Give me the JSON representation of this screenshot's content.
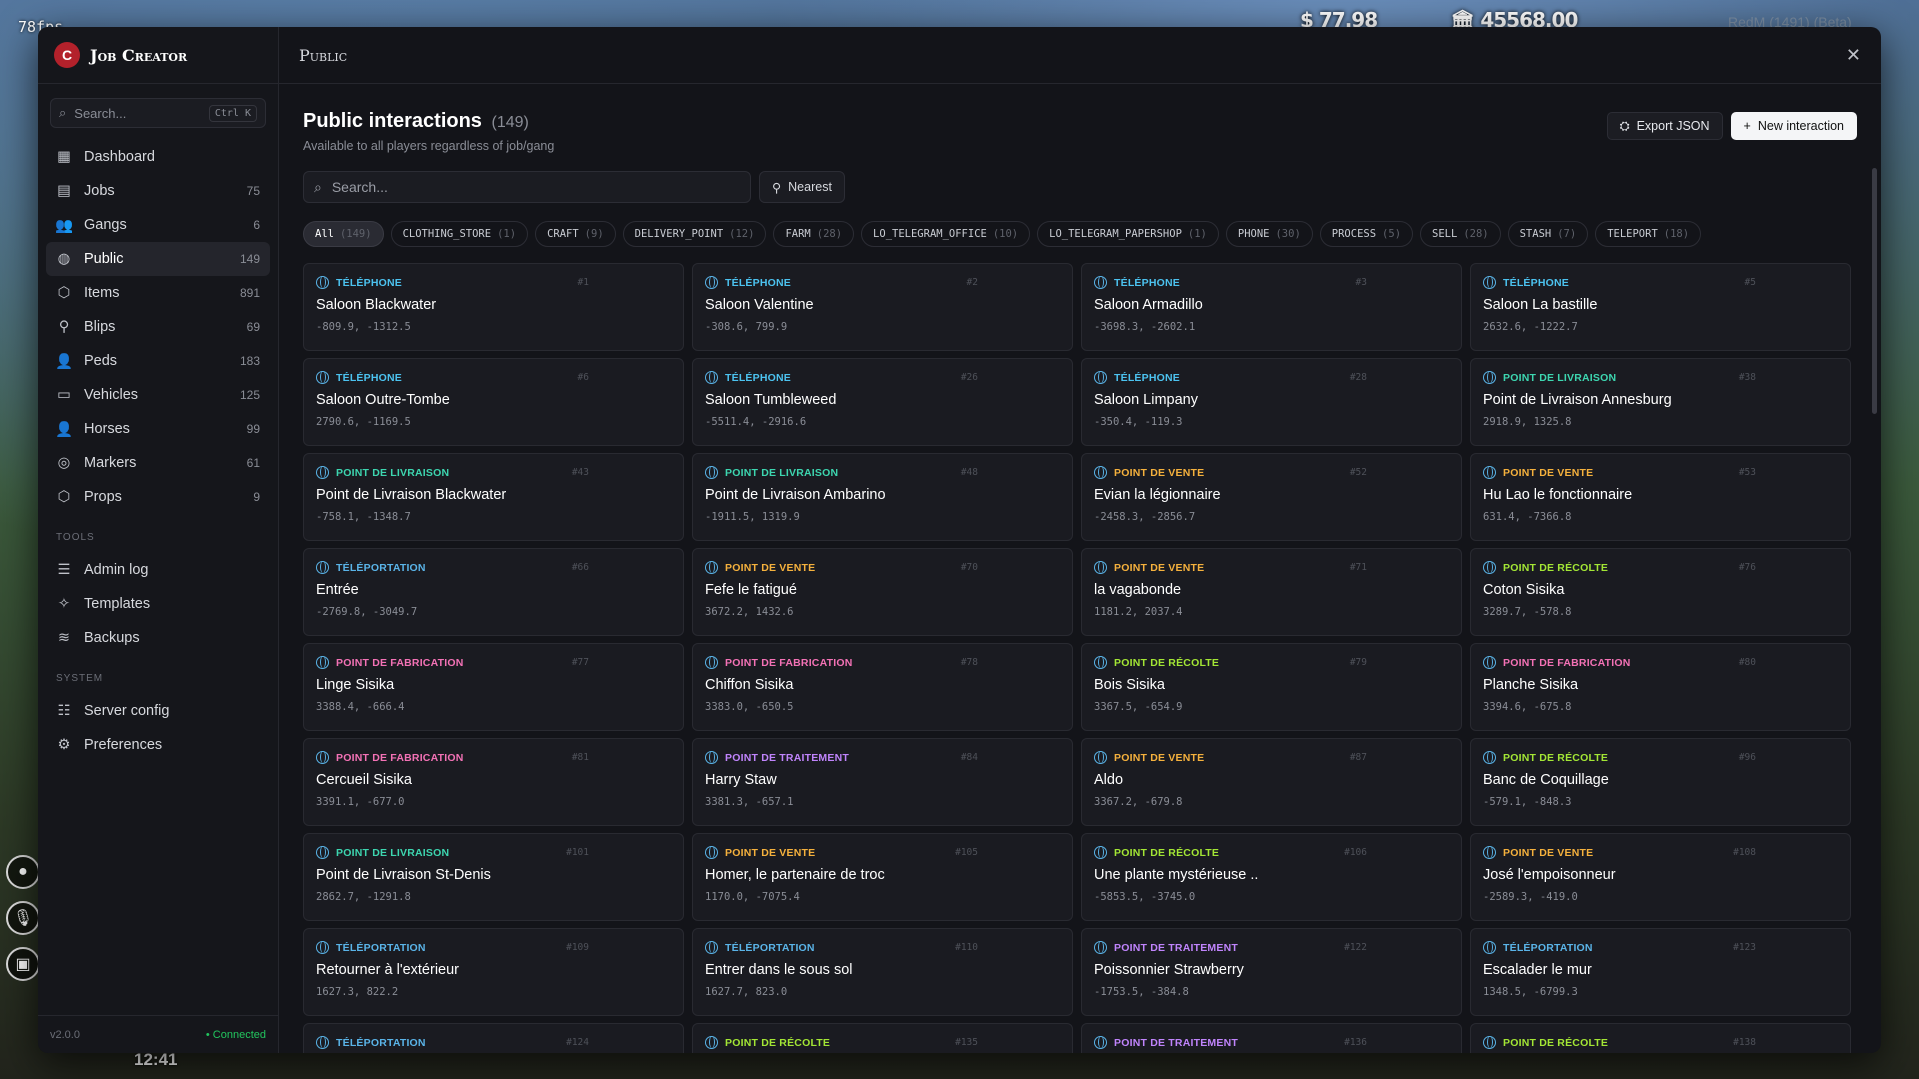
{
  "hud": {
    "fps": "78fps",
    "money": "$ 77.98",
    "bank": "🏛 45568.00",
    "server": "RedM (1491) (Beta)",
    "clock": "12:41"
  },
  "app": {
    "title": "Job Creator",
    "version": "v2.0.0",
    "status": "• Connected"
  },
  "sidebar": {
    "search_placeholder": "Search...",
    "shortcut": "Ctrl K",
    "items": [
      {
        "label": "Dashboard",
        "count": "",
        "icon": "grid-icon"
      },
      {
        "label": "Jobs",
        "count": "75",
        "icon": "briefcase-icon"
      },
      {
        "label": "Gangs",
        "count": "6",
        "icon": "users-icon"
      },
      {
        "label": "Public",
        "count": "149",
        "icon": "globe-icon"
      },
      {
        "label": "Items",
        "count": "891",
        "icon": "cube-icon"
      },
      {
        "label": "Blips",
        "count": "69",
        "icon": "pin-icon"
      },
      {
        "label": "Peds",
        "count": "183",
        "icon": "user-icon"
      },
      {
        "label": "Vehicles",
        "count": "125",
        "icon": "car-icon"
      },
      {
        "label": "Horses",
        "count": "99",
        "icon": "user-icon"
      },
      {
        "label": "Markers",
        "count": "61",
        "icon": "target-icon"
      },
      {
        "label": "Props",
        "count": "9",
        "icon": "cube-icon"
      }
    ],
    "tools_label": "Tools",
    "tools": [
      {
        "label": "Admin log",
        "icon": "log-icon"
      },
      {
        "label": "Templates",
        "icon": "sparkle-icon"
      },
      {
        "label": "Backups",
        "icon": "database-icon"
      }
    ],
    "system_label": "System",
    "system": [
      {
        "label": "Server config",
        "icon": "sliders-icon"
      },
      {
        "label": "Preferences",
        "icon": "gear-icon"
      }
    ]
  },
  "topbar": {
    "title": "Public"
  },
  "page": {
    "title": "Public interactions",
    "count": "(149)",
    "subtitle": "Available to all players regardless of job/gang",
    "export_label": "Export JSON",
    "new_label": "New interaction",
    "search_placeholder": "Search...",
    "nearest_label": "Nearest"
  },
  "chips": [
    {
      "label": "All",
      "n": "(149)"
    },
    {
      "label": "CLOTHING_STORE",
      "n": "(1)"
    },
    {
      "label": "CRAFT",
      "n": "(9)"
    },
    {
      "label": "DELIVERY_POINT",
      "n": "(12)"
    },
    {
      "label": "FARM",
      "n": "(28)"
    },
    {
      "label": "LO_TELEGRAM_OFFICE",
      "n": "(10)"
    },
    {
      "label": "LO_TELEGRAM_PAPERSHOP",
      "n": "(1)"
    },
    {
      "label": "PHONE",
      "n": "(30)"
    },
    {
      "label": "PROCESS",
      "n": "(5)"
    },
    {
      "label": "SELL",
      "n": "(28)"
    },
    {
      "label": "STASH",
      "n": "(7)"
    },
    {
      "label": "TELEPORT",
      "n": "(18)"
    }
  ],
  "colors": {
    "phone": "#4cc3f0",
    "delivery": "#3dd6b0",
    "sell": "#f5b13d",
    "teleport": "#5ab4e8",
    "farm": "#a3e635",
    "craft": "#f472b6",
    "process": "#c084fc"
  },
  "cards": [
    {
      "type": "TÉLÉPHONE",
      "color": "#4cc3f0",
      "id": "#1",
      "name": "Saloon Blackwater",
      "coords": "-809.9, -1312.5"
    },
    {
      "type": "TÉLÉPHONE",
      "color": "#4cc3f0",
      "id": "#2",
      "name": "Saloon Valentine",
      "coords": "-308.6, 799.9"
    },
    {
      "type": "TÉLÉPHONE",
      "color": "#4cc3f0",
      "id": "#3",
      "name": "Saloon Armadillo",
      "coords": "-3698.3, -2602.1"
    },
    {
      "type": "TÉLÉPHONE",
      "color": "#4cc3f0",
      "id": "#5",
      "name": "Saloon La bastille",
      "coords": "2632.6, -1222.7"
    },
    {
      "type": "TÉLÉPHONE",
      "color": "#4cc3f0",
      "id": "#6",
      "name": "Saloon Outre-Tombe",
      "coords": "2790.6, -1169.5"
    },
    {
      "type": "TÉLÉPHONE",
      "color": "#4cc3f0",
      "id": "#26",
      "name": "Saloon Tumbleweed",
      "coords": "-5511.4, -2916.6"
    },
    {
      "type": "TÉLÉPHONE",
      "color": "#4cc3f0",
      "id": "#28",
      "name": "Saloon Limpany",
      "coords": "-350.4, -119.3"
    },
    {
      "type": "POINT DE LIVRAISON",
      "color": "#3dd6b0",
      "id": "#38",
      "name": "Point de Livraison Annesburg",
      "coords": "2918.9, 1325.8"
    },
    {
      "type": "POINT DE LIVRAISON",
      "color": "#3dd6b0",
      "id": "#43",
      "name": "Point de Livraison Blackwater",
      "coords": "-758.1, -1348.7"
    },
    {
      "type": "POINT DE LIVRAISON",
      "color": "#3dd6b0",
      "id": "#48",
      "name": "Point de Livraison Ambarino",
      "coords": "-1911.5, 1319.9"
    },
    {
      "type": "POINT DE VENTE",
      "color": "#f5b13d",
      "id": "#52",
      "name": "Evian la légionnaire",
      "coords": "-2458.3, -2856.7"
    },
    {
      "type": "POINT DE VENTE",
      "color": "#f5b13d",
      "id": "#53",
      "name": "Hu Lao le fonctionnaire",
      "coords": "631.4, -7366.8"
    },
    {
      "type": "TÉLÉPORTATION",
      "color": "#5ab4e8",
      "id": "#66",
      "name": "Entrée",
      "coords": "-2769.8, -3049.7"
    },
    {
      "type": "POINT DE VENTE",
      "color": "#f5b13d",
      "id": "#70",
      "name": "Fefe le fatigué",
      "coords": "3672.2, 1432.6"
    },
    {
      "type": "POINT DE VENTE",
      "color": "#f5b13d",
      "id": "#71",
      "name": "la vagabonde",
      "coords": "1181.2, 2037.4"
    },
    {
      "type": "POINT DE RÉCOLTE",
      "color": "#a3e635",
      "id": "#76",
      "name": "Coton Sisika",
      "coords": "3289.7, -578.8"
    },
    {
      "type": "POINT DE FABRICATION",
      "color": "#f472b6",
      "id": "#77",
      "name": "Linge Sisika",
      "coords": "3388.4, -666.4"
    },
    {
      "type": "POINT DE FABRICATION",
      "color": "#f472b6",
      "id": "#78",
      "name": "Chiffon Sisika",
      "coords": "3383.0, -650.5"
    },
    {
      "type": "POINT DE RÉCOLTE",
      "color": "#a3e635",
      "id": "#79",
      "name": "Bois Sisika",
      "coords": "3367.5, -654.9"
    },
    {
      "type": "POINT DE FABRICATION",
      "color": "#f472b6",
      "id": "#80",
      "name": "Planche Sisika",
      "coords": "3394.6, -675.8"
    },
    {
      "type": "POINT DE FABRICATION",
      "color": "#f472b6",
      "id": "#81",
      "name": "Cercueil Sisika",
      "coords": "3391.1, -677.0"
    },
    {
      "type": "POINT DE TRAITEMENT",
      "color": "#c084fc",
      "id": "#84",
      "name": "Harry Staw",
      "coords": "3381.3, -657.1"
    },
    {
      "type": "POINT DE VENTE",
      "color": "#f5b13d",
      "id": "#87",
      "name": "Aldo",
      "coords": "3367.2, -679.8"
    },
    {
      "type": "POINT DE RÉCOLTE",
      "color": "#a3e635",
      "id": "#96",
      "name": "Banc de Coquillage",
      "coords": "-579.1, -848.3"
    },
    {
      "type": "POINT DE LIVRAISON",
      "color": "#3dd6b0",
      "id": "#101",
      "name": "Point de Livraison St-Denis",
      "coords": "2862.7, -1291.8"
    },
    {
      "type": "POINT DE VENTE",
      "color": "#f5b13d",
      "id": "#105",
      "name": "Homer, le partenaire de troc",
      "coords": "1170.0, -7075.4"
    },
    {
      "type": "POINT DE RÉCOLTE",
      "color": "#a3e635",
      "id": "#106",
      "name": "Une plante mystérieuse ..",
      "coords": "-5853.5, -3745.0"
    },
    {
      "type": "POINT DE VENTE",
      "color": "#f5b13d",
      "id": "#108",
      "name": "José l'empoisonneur",
      "coords": "-2589.3, -419.0"
    },
    {
      "type": "TÉLÉPORTATION",
      "color": "#5ab4e8",
      "id": "#109",
      "name": "Retourner à l'extérieur",
      "coords": "1627.3, 822.2"
    },
    {
      "type": "TÉLÉPORTATION",
      "color": "#5ab4e8",
      "id": "#110",
      "name": "Entrer dans le sous sol",
      "coords": "1627.7, 823.0"
    },
    {
      "type": "POINT DE TRAITEMENT",
      "color": "#c084fc",
      "id": "#122",
      "name": "Poissonnier Strawberry",
      "coords": "-1753.5, -384.8"
    },
    {
      "type": "TÉLÉPORTATION",
      "color": "#5ab4e8",
      "id": "#123",
      "name": "Escalader le mur",
      "coords": "1348.5, -6799.3"
    },
    {
      "type": "TÉLÉPORTATION",
      "color": "#5ab4e8",
      "id": "#124",
      "name": "",
      "coords": ""
    },
    {
      "type": "POINT DE RÉCOLTE",
      "color": "#a3e635",
      "id": "#135",
      "name": "",
      "coords": ""
    },
    {
      "type": "POINT DE TRAITEMENT",
      "color": "#c084fc",
      "id": "#136",
      "name": "",
      "coords": ""
    },
    {
      "type": "POINT DE RÉCOLTE",
      "color": "#a3e635",
      "id": "#138",
      "name": "",
      "coords": ""
    }
  ]
}
